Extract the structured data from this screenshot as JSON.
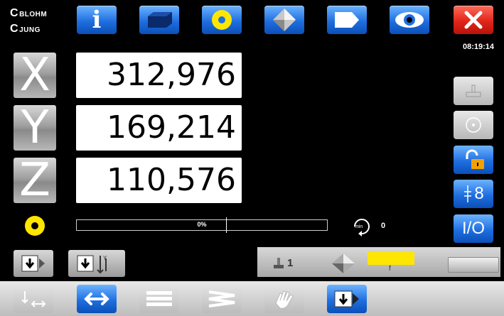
{
  "brand": {
    "line1": "BLOHM",
    "line2": "JUNG"
  },
  "toolbar": {
    "info_icon": "info-icon",
    "items": [
      "info-icon",
      "workpiece-icon",
      "circle-icon",
      "diamond-icon",
      "arrow-box-icon",
      "eye-icon",
      "close-icon"
    ]
  },
  "clock": "08:19:14",
  "axes": [
    {
      "label": "X",
      "value": "312,976"
    },
    {
      "label": "Y",
      "value": "169,214"
    },
    {
      "label": "Z",
      "value": "110,576"
    }
  ],
  "progress": {
    "percent_label": "0%",
    "value": 0
  },
  "spindle": {
    "unit": "min",
    "value": "0"
  },
  "right_panel": {
    "io_label": "I/O",
    "counter_label": "8"
  },
  "tool_bar": {
    "tool_number": "1",
    "sublabel": "f"
  },
  "colors": {
    "accent_blue": "#1f6fe0",
    "close_red": "#e0261a",
    "indicator_yellow": "#ffe600"
  }
}
